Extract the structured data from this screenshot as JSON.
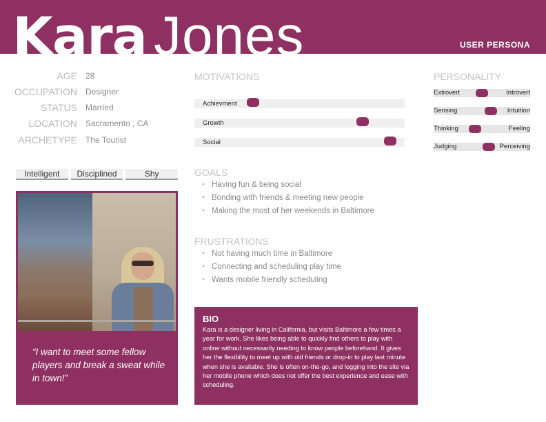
{
  "header": {
    "first_name": "Kara",
    "last_name": "Jones",
    "label": "USER PERSONA"
  },
  "details": [
    {
      "label": "AGE",
      "value": "28"
    },
    {
      "label": "OCCUPATION",
      "value": "Designer"
    },
    {
      "label": "STATUS",
      "value": "Married"
    },
    {
      "label": "LOCATION",
      "value": "Sacramento , CA"
    },
    {
      "label": "ARCHETYPE",
      "value": "The Tourist"
    }
  ],
  "traits": [
    "Intelligent",
    "Disciplined",
    "Shy"
  ],
  "quote": "“I want to meet some fellow players and break a sweat while in town!”",
  "motivations": {
    "title": "MOTIVATIONS",
    "items": [
      {
        "label": "Achievment",
        "level": 0.28
      },
      {
        "label": "Growth",
        "level": 0.8
      },
      {
        "label": "Social",
        "level": 0.93
      }
    ]
  },
  "goals": {
    "title": "GOALS",
    "items": [
      "Having fun & being social",
      "Bonding with friends & meeting new people",
      "Making the most of her weekends in Baltimore"
    ]
  },
  "frustrations": {
    "title": "FRUSTRATIONS",
    "items": [
      "Not having much time in Baltimore",
      "Connecting and scheduling play time",
      "Wants mobile friendly scheduling"
    ]
  },
  "bio": {
    "title": "BIO",
    "text": "Kara is a designer living in California, but visits Baltimore a few times a year for work.  She likes being able to quickly find others to play with online without necessarily needing to know people beforehand.  It gives her the flexibility to meet up with old friends or drop-in to play last minute when she is available. She is often on-the-go, and logging into the site via her mobile phone which does not offer the best experience and ease with scheduling."
  },
  "personality": {
    "title": "PERSONALITY",
    "items": [
      {
        "left": "Extrovert",
        "right": "Introvert",
        "level": 0.5
      },
      {
        "left": "Sensing",
        "right": "Intuition",
        "level": 0.59
      },
      {
        "left": "Thinking",
        "right": "Feeling",
        "level": 0.43
      },
      {
        "left": "Judging",
        "right": "Perceiving",
        "level": 0.57
      }
    ]
  },
  "colors": {
    "accent": "#8e3061"
  }
}
